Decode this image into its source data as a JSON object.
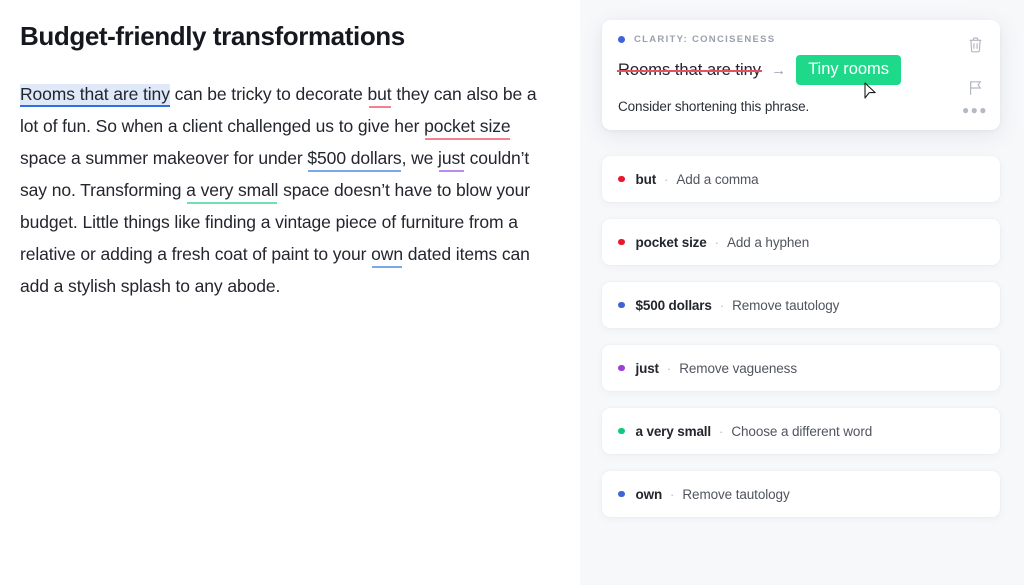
{
  "document": {
    "title": "Budget-friendly transformations",
    "paragraph_segments": [
      {
        "text": "Rooms that ",
        "style": "selected"
      },
      {
        "text": "caret",
        "style": "caret"
      },
      {
        "text": "are tiny",
        "style": "selected"
      },
      {
        "text": " can be tricky to decorate ",
        "style": "plain"
      },
      {
        "text": "but",
        "style": "underline-red"
      },
      {
        "text": " they can also be a lot of fun.  So when a client challenged us to give her ",
        "style": "plain"
      },
      {
        "text": "pocket size",
        "style": "underline-red"
      },
      {
        "text": " space a summer makeover for under ",
        "style": "plain"
      },
      {
        "text": "$500 dollars",
        "style": "underline-blue"
      },
      {
        "text": ", we ",
        "style": "plain"
      },
      {
        "text": "just",
        "style": "underline-purple"
      },
      {
        "text": " couldn’t say no. Transforming ",
        "style": "plain"
      },
      {
        "text": "a very small",
        "style": "underline-green"
      },
      {
        "text": " space doesn’t have to blow your budget. Little things like finding a vintage piece of furniture from a relative or adding a fresh coat of paint to your ",
        "style": "plain"
      },
      {
        "text": "own",
        "style": "underline-blue"
      },
      {
        "text": " dated items can add a stylish splash to any abode.",
        "style": "plain"
      }
    ]
  },
  "sidebar": {
    "main_card": {
      "category": "CLARITY: CONCISENESS",
      "category_dot_color": "#3f63d8",
      "original_text": "Rooms that are tiny",
      "arrow": "→",
      "replacement_text": "Tiny rooms",
      "replacement_color": "#1ed98a",
      "explanation": "Consider shortening this phrase.",
      "actions": {
        "delete_icon": "trash-icon",
        "flag_icon": "flag-icon",
        "more_icon": "●●●",
        "more_label": "•••"
      }
    },
    "suggestions": [
      {
        "term": "but",
        "separator": "·",
        "action": "Add a comma",
        "dot_color": "#e8172e"
      },
      {
        "term": "pocket size",
        "separator": "·",
        "action": "Add a hyphen",
        "dot_color": "#e8172e"
      },
      {
        "term": "$500 dollars",
        "separator": "·",
        "action": "Remove tautology",
        "dot_color": "#3f63d8"
      },
      {
        "term": "just",
        "separator": "·",
        "action": "Remove vagueness",
        "dot_color": "#9b3fd8"
      },
      {
        "term": "a very small",
        "separator": "·",
        "action": "Choose a different word",
        "dot_color": "#11c97e"
      },
      {
        "term": "own",
        "separator": "·",
        "action": "Remove tautology",
        "dot_color": "#3f63d8"
      }
    ]
  },
  "colors": {
    "background": "#ffffff",
    "sidebar_background": "#f7f8fa",
    "text": "#23262e",
    "accent_green": "#1ed98a",
    "accent_blue": "#3f63d8",
    "strike_red": "#e8505f"
  }
}
